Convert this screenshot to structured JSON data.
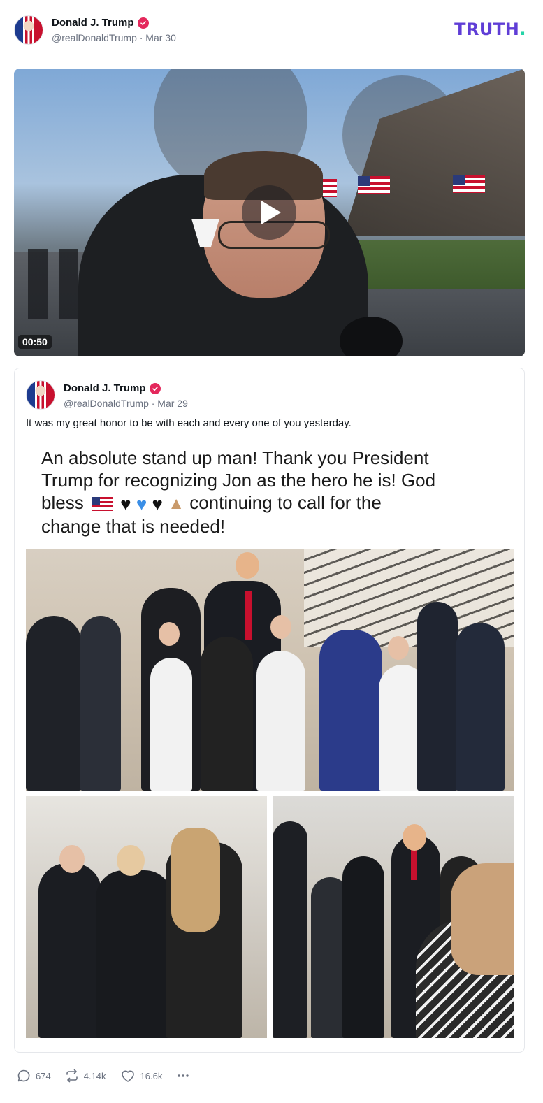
{
  "post": {
    "author": {
      "display_name": "Donald J. Trump",
      "handle_date": "@realDonaldTrump · Mar 30",
      "verified_icon": "verified-badge-icon"
    },
    "brand": {
      "logo_text": "TRUTH",
      "logo_dot": ".",
      "logo_color": "#5f3dd6",
      "dot_color": "#25d4a8"
    },
    "video": {
      "duration": "00:50",
      "play_icon": "play-icon"
    }
  },
  "quoted": {
    "author": {
      "display_name": "Donald J. Trump",
      "handle_date": "@realDonaldTrump · Mar 29"
    },
    "text": "It was my great honor to be with each and every one of you yesterday.",
    "image_caption": {
      "line1": "An absolute stand up man! Thank you President",
      "line2": "Trump for recognizing Jon as the hero he is! God",
      "line3_start": "bless",
      "line3_end": "continuing to call for the",
      "line4": "change that is needed!"
    }
  },
  "actions": {
    "replies": "674",
    "retruths": "4.14k",
    "likes": "16.6k"
  },
  "colors": {
    "accent": "#5f3dd6",
    "verified": "#e4285c",
    "muted": "#6b7280"
  }
}
